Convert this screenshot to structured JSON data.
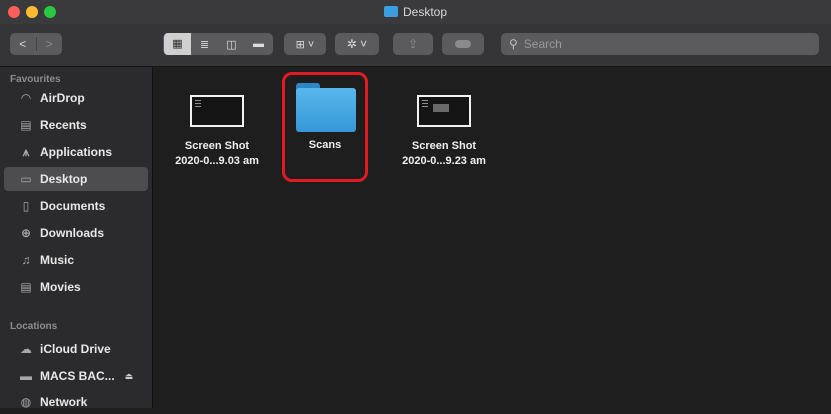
{
  "window": {
    "title": "Desktop",
    "colors": {
      "close": "#ff5f57",
      "minimize": "#febc2e",
      "zoom": "#28c840",
      "selection_outline": "#e01b24",
      "folder": "#3a9fe0"
    }
  },
  "toolbar": {
    "back_label": "<",
    "forward_label": ">",
    "view_icons": [
      "icon-view-icon",
      "list-view-icon",
      "column-view-icon",
      "gallery-view-icon"
    ],
    "group_label": "⊞ ˅",
    "action_label": "✲ ˅",
    "share_icon": "share-icon",
    "tag_icon": "tag-icon",
    "search": {
      "placeholder": "Search",
      "value": ""
    }
  },
  "sidebar": {
    "favourites_heading": "Favourites",
    "favourites": [
      {
        "label": "AirDrop",
        "icon": "airdrop-icon"
      },
      {
        "label": "Recents",
        "icon": "recents-icon"
      },
      {
        "label": "Applications",
        "icon": "applications-icon"
      },
      {
        "label": "Desktop",
        "icon": "desktop-icon",
        "selected": true
      },
      {
        "label": "Documents",
        "icon": "documents-icon"
      },
      {
        "label": "Downloads",
        "icon": "downloads-icon"
      },
      {
        "label": "Music",
        "icon": "music-icon"
      },
      {
        "label": "Movies",
        "icon": "movies-icon"
      }
    ],
    "locations_heading": "Locations",
    "locations": [
      {
        "label": "iCloud Drive",
        "icon": "icloud-icon"
      },
      {
        "label": "MACS BAC...",
        "icon": "drive-icon",
        "eject": "⏏"
      },
      {
        "label": "Network",
        "icon": "network-icon"
      }
    ]
  },
  "files": [
    {
      "name_line1": "Screen Shot",
      "name_line2": "2020-0...9.03 am",
      "type": "screenshot"
    },
    {
      "name_line1": "Scans",
      "name_line2": "",
      "type": "folder",
      "highlighted": true
    },
    {
      "name_line1": "Screen Shot",
      "name_line2": "2020-0...9.23 am",
      "type": "screenshot"
    }
  ]
}
